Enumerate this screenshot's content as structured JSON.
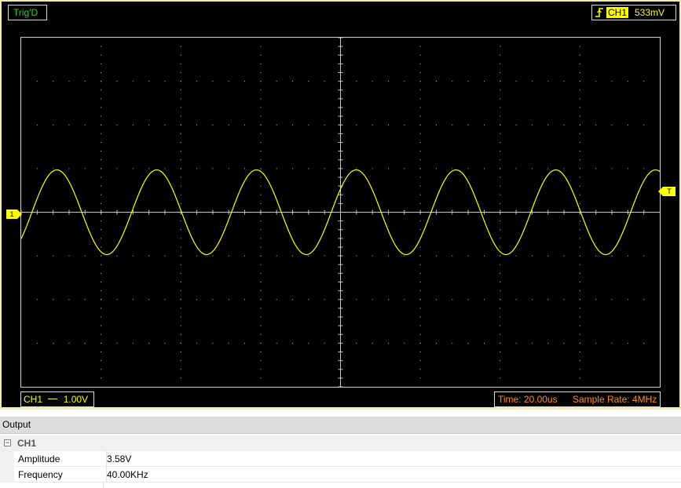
{
  "scope": {
    "trigger_status": "Trig'D",
    "trigger_channel": "CH1",
    "trigger_level": "533mV",
    "ch1_marker": "1",
    "trigger_marker": "T",
    "ch1_scale_channel": "CH1",
    "ch1_scale_value": "1.00V",
    "time_label": "Time: 20.00us",
    "sample_rate_label": "Sample Rate: 4MHz",
    "colors": {
      "trace": "#ffff00",
      "grid": "#c8c8c8",
      "trig_status_text": "#29d629",
      "timebase_text": "#ff8c1a",
      "frame": "#f3ecb0"
    },
    "icons": [
      "rising-edge-trigger-icon",
      "dc-coupling-icon"
    ]
  },
  "waveform": {
    "shape": "sine",
    "divisions": {
      "horizontal": 8,
      "vertical": 8
    },
    "volts_per_div": 1.0,
    "seconds_per_div": 2e-05,
    "amplitude_volts": 0.97,
    "frequency_hz": 40000,
    "trigger_level_volts": 0.533,
    "trigger_edge": "rising"
  },
  "output": {
    "header": "Output",
    "group_label": "CH1",
    "expander_symbol": "⊟",
    "rows": [
      {
        "name": "Amplitude",
        "value": "3.58V"
      },
      {
        "name": "Frequency",
        "value": "40.00KHz"
      }
    ]
  }
}
